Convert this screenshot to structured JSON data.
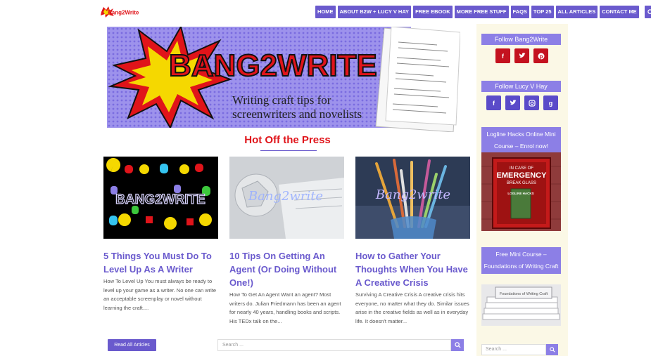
{
  "header": {
    "logo_text": "Bang2Write",
    "nav": [
      "HOME",
      "ABOUT B2W + LUCY V HAY",
      "FREE EBOOK",
      "MORE FREE STUFF",
      "FAQS",
      "TOP 25",
      "ALL ARTICLES",
      "CONTACT ME"
    ],
    "search_icon": "search-icon"
  },
  "banner": {
    "brand": "BANG2WRITE",
    "tagline_1": "Writing craft tips for",
    "tagline_2": "screenwriters and novelists"
  },
  "section_title": "Hot Off the Press",
  "cards": [
    {
      "title": "5 Things You Must Do To Level Up As A Writer",
      "excerpt": "How To Level Up  You must always be ready to level up your game as a writer. No one can write an acceptable screenplay or novel without learning the craft....",
      "image_text": "BANG2WRITE"
    },
    {
      "title": "10 Tips On Getting An Agent (Or Doing Without One!)",
      "excerpt": "How To Get An Agent Want an agent? Most writers do.  Julian Friedmann has been an agent for nearly 40 years, handling books and scripts. His TEDx talk on the...",
      "image_text": "Bang2write"
    },
    {
      "title": "How to Gather Your Thoughts When You Have A Creative Crisis",
      "excerpt": "Surviving A Creative Crisis A creative crisis hits everyone, no matter what they do.  Similar issues arise in the creative fields as well as in everyday life. It doesn't matter...",
      "image_text": "Bang2write"
    }
  ],
  "read_all_label": "Read All Articles",
  "search_placeholder": "Search ...",
  "sidebar": {
    "follow_b2w": "Follow Bang2Write",
    "follow_lucy": "Follow Lucy V Hay",
    "course_1": "Logline Hacks Online Mini Course – Enrol now!",
    "course_1_image_text_1": "IN CASE OF",
    "course_1_image_text_2": "EMERGENCY",
    "course_1_image_text_3": "BREAK GLASS",
    "course_1_book": "LOGLINE HACKS",
    "course_2": "Free Mini Course – Foundations of Writing Craft",
    "course_2_image_text": "Foundations of Writing Craft",
    "search_placeholder": "Search ..."
  },
  "colors": {
    "accent": "#6a5acd",
    "accent_light": "#8c7fe6",
    "red": "#e0141a",
    "sidebar_bg": "#fbf8e6"
  }
}
